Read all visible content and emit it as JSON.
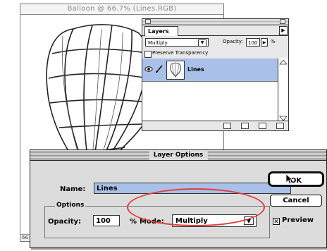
{
  "document": {
    "title": "Balloon @ 66.7% (Lines,RGB)",
    "zoom_readout": "66"
  },
  "layers_palette": {
    "tab_label": "Layers",
    "blend_mode": "Multiply",
    "opacity_label": "Opacity:",
    "opacity_value": "100",
    "percent_sign": "%",
    "preserve_transparency_label": "Preserve Transparency",
    "preserve_transparency_checked": false,
    "layers": [
      {
        "name": "Lines",
        "visible": true,
        "selected": true
      }
    ]
  },
  "dialog": {
    "title": "Layer Options",
    "name_label": "Name:",
    "name_value": "Lines",
    "options_legend": "Options",
    "opacity_label": "Opacity:",
    "opacity_value": "100",
    "percent_sign": "%",
    "mode_label": "Mode:",
    "mode_value": "Multiply",
    "ok_label": "OK",
    "cancel_label": "Cancel",
    "preview_label": "Preview",
    "preview_checked": true
  },
  "colors": {
    "selection_blue": "#a9c0e8",
    "highlight_red": "#e04040"
  },
  "icons": {
    "eye": "eye-icon",
    "brush": "brush-icon",
    "palette_menu": "triangle-right-icon",
    "new_layer": "new-layer-icon",
    "trash": "trash-icon",
    "mode_dropdown": "triangle-down-icon",
    "cursor": "arrow-pointer-icon"
  }
}
